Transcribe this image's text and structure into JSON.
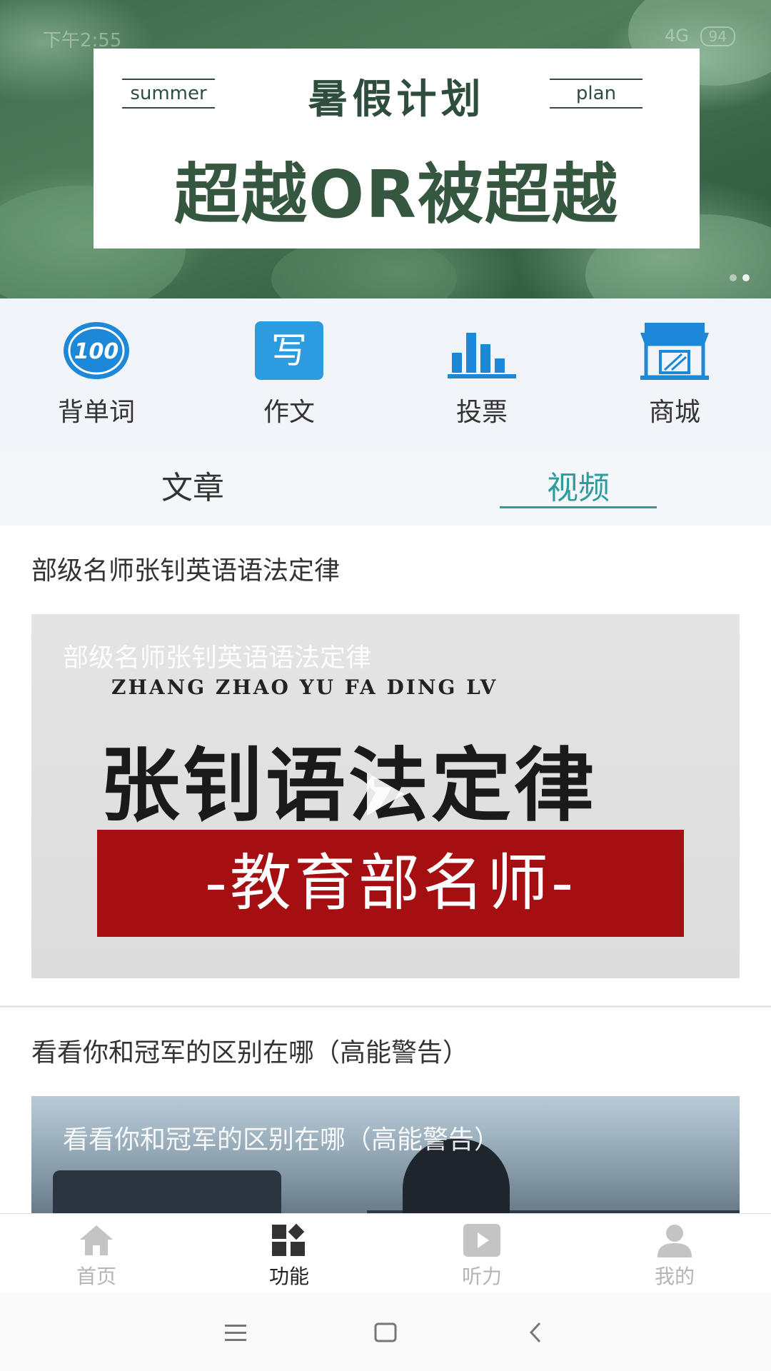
{
  "status_bar": {
    "time": "下午2:55",
    "network": "4G",
    "battery": "94"
  },
  "banner": {
    "tag_left": "summer",
    "tag_right": "plan",
    "title": "暑假计划",
    "headline": "超越OR被超越",
    "slide_count": 2,
    "active_slide": 2
  },
  "quick_actions": [
    {
      "label": "背单词",
      "icon": "score-100-icon",
      "icon_text": "100"
    },
    {
      "label": "作文",
      "icon": "write-icon",
      "icon_text": "写"
    },
    {
      "label": "投票",
      "icon": "bar-chart-icon"
    },
    {
      "label": "商城",
      "icon": "store-icon"
    }
  ],
  "tabs": [
    {
      "label": "文章",
      "active": false
    },
    {
      "label": "视频",
      "active": true
    }
  ],
  "feed": [
    {
      "title": "部级名师张钊英语语法定律",
      "thumb_overlay_title": "部级名师张钊英语语法定律",
      "thumb_pinyin": "ZHANG ZHAO YU FA DING LV",
      "thumb_big_text": "张钊语法定律",
      "thumb_banner_text": "-教育部名师-"
    },
    {
      "title": "看看你和冠军的区别在哪（高能警告）",
      "thumb_overlay_title": "看看你和冠军的区别在哪（高能警告）"
    }
  ],
  "bottom_nav": [
    {
      "label": "首页",
      "icon": "home-icon",
      "active": false
    },
    {
      "label": "功能",
      "icon": "grid-icon",
      "active": true
    },
    {
      "label": "听力",
      "icon": "play-icon",
      "active": false
    },
    {
      "label": "我的",
      "icon": "user-icon",
      "active": false
    }
  ],
  "colors": {
    "accent": "#2e9c9c",
    "icon_blue": "#1e88d8",
    "thumb_red": "#a50f12"
  }
}
